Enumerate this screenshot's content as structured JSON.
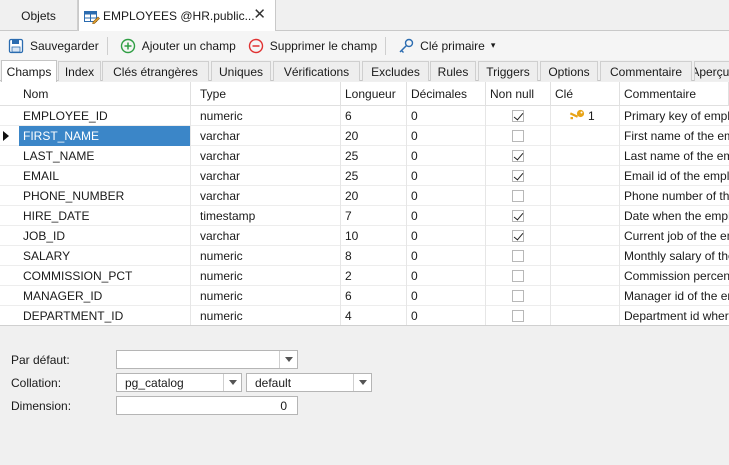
{
  "doc_tabs": {
    "objects_label": "Objets",
    "active_label": "EMPLOYEES @HR.public...",
    "close_glyph": "✕"
  },
  "toolbar": {
    "save_label": "Sauvegarder",
    "add_field_label": "Ajouter un champ",
    "remove_field_label": "Supprimer le champ",
    "primary_key_label": "Clé primaire",
    "dropdown_glyph": "▾"
  },
  "subtabs": [
    "Champs",
    "Index",
    "Clés étrangères",
    "Uniques",
    "Vérifications",
    "Excludes",
    "Rules",
    "Triggers",
    "Options",
    "Commentaire",
    "Aperçu SQL"
  ],
  "columns": [
    "Nom",
    "Type",
    "Longueur",
    "Décimales",
    "Non null",
    "Clé",
    "Commentaire"
  ],
  "rows": [
    {
      "name": "EMPLOYEE_ID",
      "type": "numeric",
      "length": "6",
      "decimals": "0",
      "notnull": true,
      "key": "1",
      "comment": "Primary key of employees table."
    },
    {
      "name": "FIRST_NAME",
      "type": "varchar",
      "length": "20",
      "decimals": "0",
      "notnull": false,
      "key": "",
      "comment": "First name of the employee."
    },
    {
      "name": "LAST_NAME",
      "type": "varchar",
      "length": "25",
      "decimals": "0",
      "notnull": true,
      "key": "",
      "comment": "Last name of the employee."
    },
    {
      "name": "EMAIL",
      "type": "varchar",
      "length": "25",
      "decimals": "0",
      "notnull": true,
      "key": "",
      "comment": "Email id of the employee."
    },
    {
      "name": "PHONE_NUMBER",
      "type": "varchar",
      "length": "20",
      "decimals": "0",
      "notnull": false,
      "key": "",
      "comment": "Phone number of the employee."
    },
    {
      "name": "HIRE_DATE",
      "type": "timestamp",
      "length": "7",
      "decimals": "0",
      "notnull": true,
      "key": "",
      "comment": "Date when the employee started."
    },
    {
      "name": "JOB_ID",
      "type": "varchar",
      "length": "10",
      "decimals": "0",
      "notnull": true,
      "key": "",
      "comment": "Current job of the employee."
    },
    {
      "name": "SALARY",
      "type": "numeric",
      "length": "8",
      "decimals": "0",
      "notnull": false,
      "key": "",
      "comment": "Monthly salary of the employee."
    },
    {
      "name": "COMMISSION_PCT",
      "type": "numeric",
      "length": "2",
      "decimals": "0",
      "notnull": false,
      "key": "",
      "comment": "Commission percentage of the employee."
    },
    {
      "name": "MANAGER_ID",
      "type": "numeric",
      "length": "6",
      "decimals": "0",
      "notnull": false,
      "key": "",
      "comment": "Manager id of the employee."
    },
    {
      "name": "DEPARTMENT_ID",
      "type": "numeric",
      "length": "4",
      "decimals": "0",
      "notnull": false,
      "key": "",
      "comment": "Department id where employee works."
    }
  ],
  "selected_row": 1,
  "props": {
    "default_label": "Par défaut:",
    "default_value": "",
    "collation_label": "Collation:",
    "collation_schema": "pg_catalog",
    "collation_value": "default",
    "dimension_label": "Dimension:",
    "dimension_value": "0"
  },
  "colors": {
    "selection": "#3b86c8",
    "key_icon": "#e8a417",
    "add_icon": "#2f9e44",
    "remove_icon": "#e03131"
  }
}
